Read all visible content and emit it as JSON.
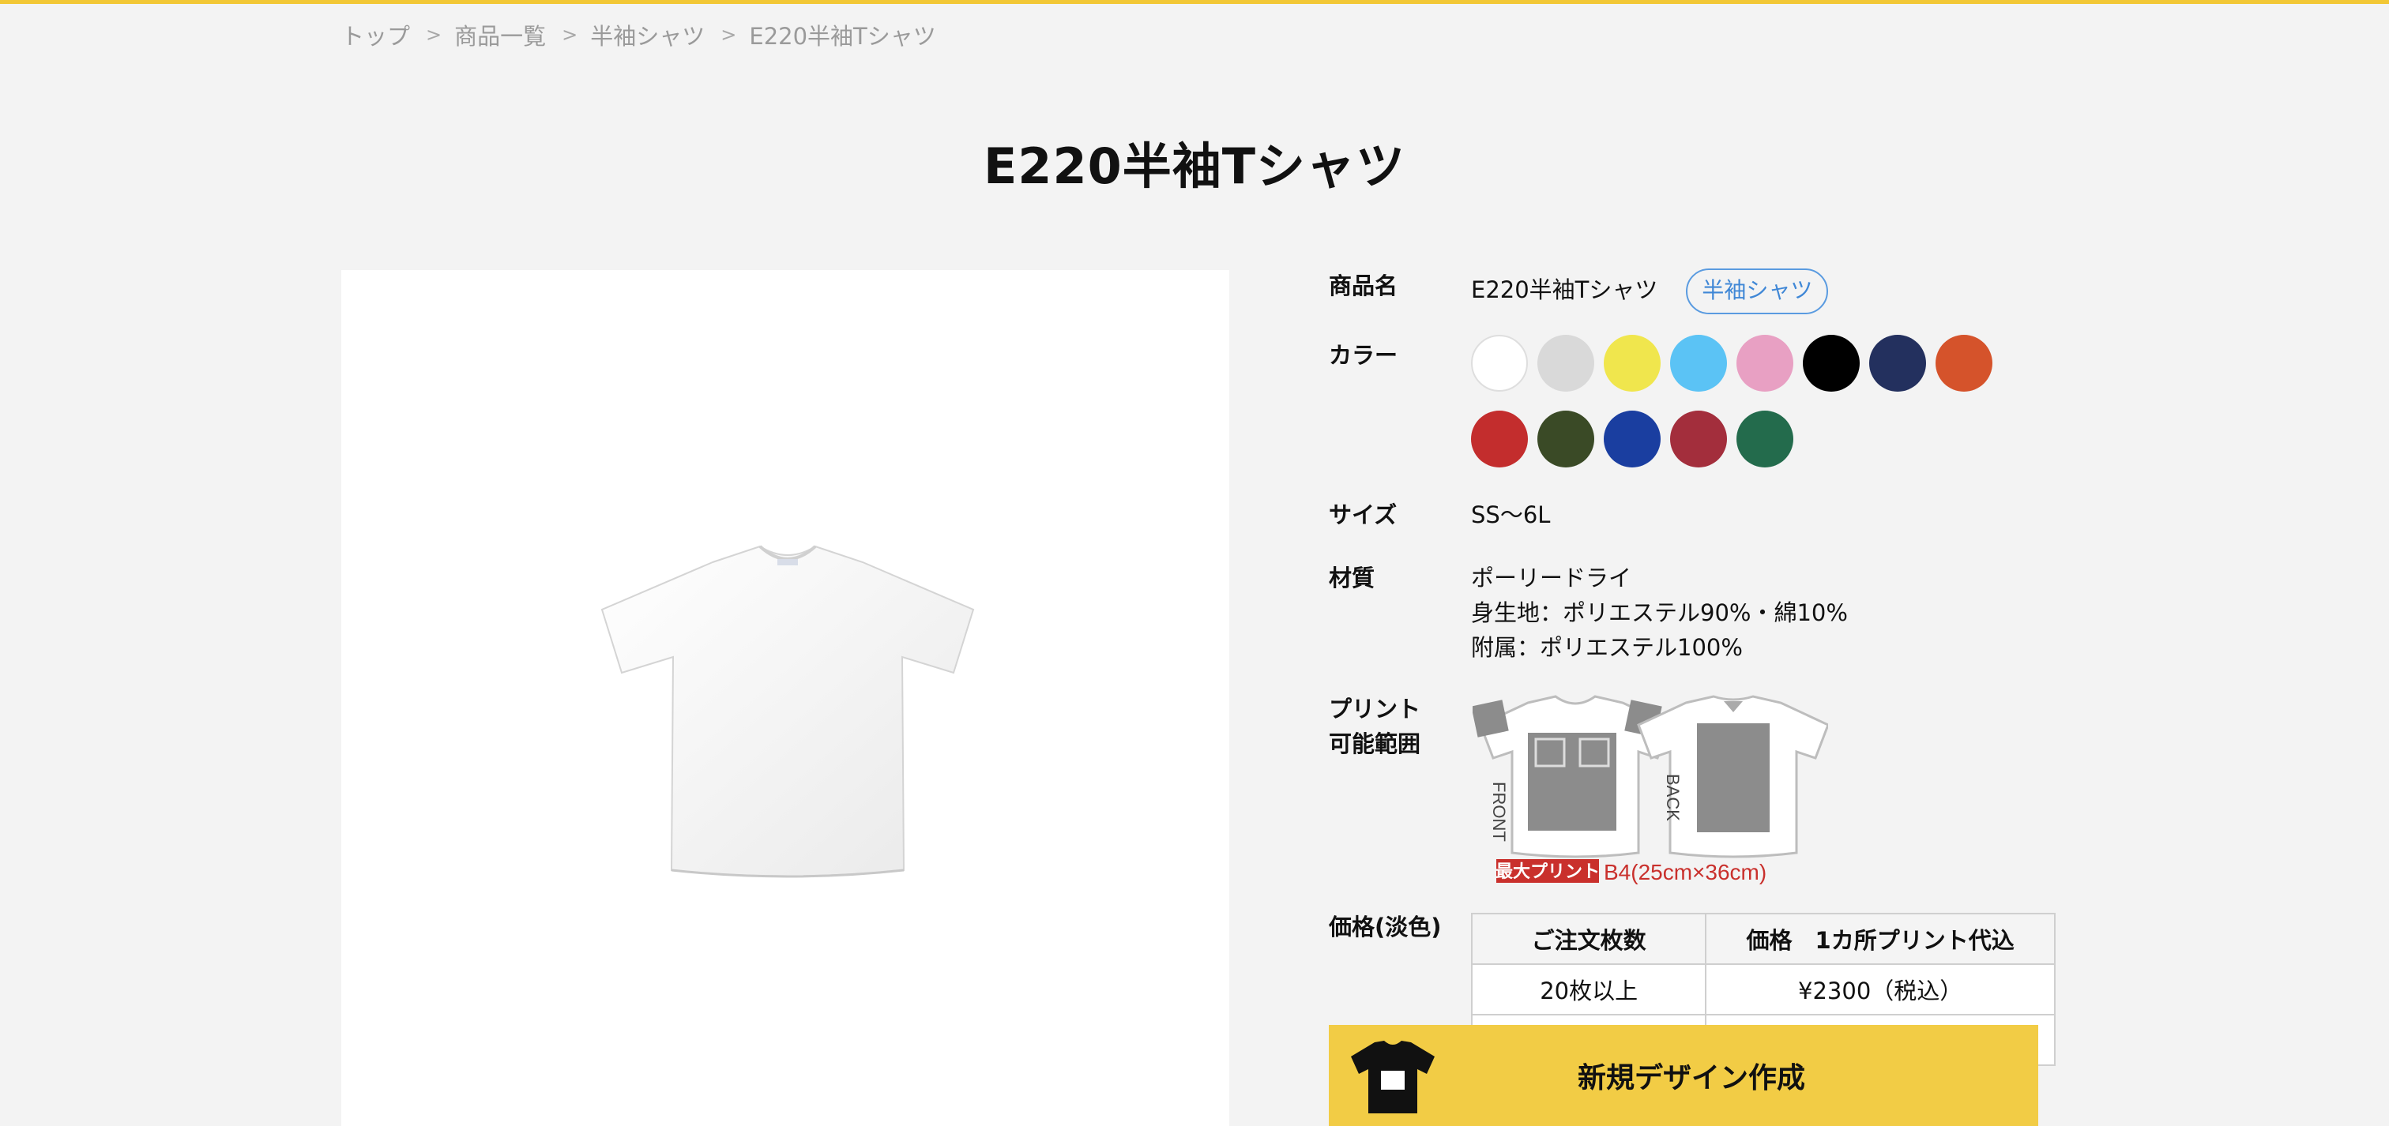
{
  "breadcrumb": {
    "items": [
      "トップ",
      "商品一覧",
      "半袖シャツ",
      "E220半袖Tシャツ"
    ],
    "separator": ">"
  },
  "page_title": "E220半袖Tシャツ",
  "product_image": {
    "alt": "white short-sleeve t-shirt"
  },
  "specs": {
    "name_label": "商品名",
    "name_value": "E220半袖Tシャツ",
    "category_tag": "半袖シャツ",
    "color_label": "カラー",
    "colors": [
      "#ffffff",
      "#d9d9d9",
      "#f0e64d",
      "#5bc3f5",
      "#e8a0c3",
      "#000000",
      "#23305e",
      "#d5532b",
      "#c32d2d",
      "#3a4a26",
      "#1a3ea0",
      "#a32e3c",
      "#236b4c"
    ],
    "size_label": "サイズ",
    "size_value": "SS〜6L",
    "material_label": "材質",
    "material_lines": [
      "ポーリードライ",
      "身生地：ポリエステル90%・綿10%",
      "附属：ポリエステル100%"
    ],
    "print_label_line1": "プリント",
    "print_label_line2": "可能範囲",
    "print_front_text": "FRONT",
    "print_back_text": "BACK",
    "print_max_badge": "最大プリント",
    "print_max_size": "B4(25cm×36cm)"
  },
  "price": {
    "label": "価格(淡色)",
    "headers": [
      "ご注文枚数",
      "価格　1カ所プリント代込"
    ],
    "rows": [
      [
        "20枚以上",
        "¥2300（税込）"
      ]
    ]
  },
  "cta": {
    "label": "新規デザイン作成",
    "icon": "tshirt-icon",
    "background": "#f2cc45"
  },
  "colors": {
    "accent": "#f2c735",
    "tag_blue": "#3f87d6"
  }
}
